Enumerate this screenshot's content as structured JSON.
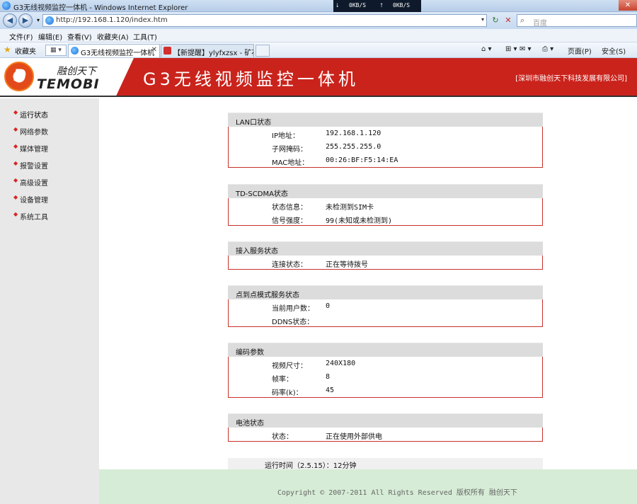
{
  "window": {
    "title": "G3无线视频监控一体机 - Windows Internet Explorer",
    "download_speed": "0KB/S",
    "upload_speed": "0KB/S"
  },
  "address_bar": {
    "url": "http://192.168.1.120/index.htm",
    "search_placeholder": "百度"
  },
  "menu": [
    "文件(F)",
    "编辑(E)",
    "查看(V)",
    "收藏夹(A)",
    "工具(T)"
  ],
  "favorites": {
    "label": "收藏夹",
    "tabs": [
      {
        "label": "G3无线视频监控一体机",
        "active": true
      },
      {
        "label": "【新提醒】ylyfxzsx - 矿石...",
        "active": false
      }
    ],
    "tools": [
      "页面(P)",
      "安全(S)"
    ]
  },
  "header": {
    "logo_cn": "融创天下",
    "logo_en": "TEMOBI",
    "title": "G3无线视频监控一体机",
    "company": "[深圳市融创天下科技发展有限公司]"
  },
  "sidebar": {
    "items": [
      "运行状态",
      "网络参数",
      "媒体管理",
      "报警设置",
      "高级设置",
      "设备管理",
      "系统工具"
    ]
  },
  "sections": [
    {
      "title": "LAN口状态",
      "rows": [
        {
          "key": "IP地址：",
          "value": "192.168.1.120"
        },
        {
          "key": "子网掩码：",
          "value": "255.255.255.0"
        },
        {
          "key": "MAC地址：",
          "value": "00:26:BF:F5:14:EA"
        }
      ]
    },
    {
      "title": "TD-SCDMA状态",
      "rows": [
        {
          "key": "状态信息：",
          "value": "未检测到SIM卡"
        },
        {
          "key": "信号强度：",
          "value": "99(未知或未检测到)"
        }
      ]
    },
    {
      "title": "接入服务状态",
      "rows": [
        {
          "key": "连接状态：",
          "value": "正在等待拨号"
        }
      ]
    },
    {
      "title": "点到点模式服务状态",
      "rows": [
        {
          "key": "当前用户数：",
          "value": "0"
        },
        {
          "key": "DDNS状态：",
          "value": ""
        }
      ]
    },
    {
      "title": "编码参数",
      "rows": [
        {
          "key": "视频尺寸：",
          "value": "240X180"
        },
        {
          "key": "帧率：",
          "value": "8"
        },
        {
          "key": "码率(k)：",
          "value": "45"
        }
      ]
    },
    {
      "title": "电池状态",
      "rows": [
        {
          "key": "状态：",
          "value": "正在使用外部供电"
        }
      ]
    }
  ],
  "uptime": "运行时间（2.5.15）：12分钟",
  "footer": "Copyright © 2007-2011 All Rights Reserved 版权所有 融创天下",
  "colors": {
    "header_red": "#ca231c",
    "sidebar_bg": "#e8e8e8",
    "section_border": "#c8302a",
    "footer_bg": "#d6ecd6"
  }
}
